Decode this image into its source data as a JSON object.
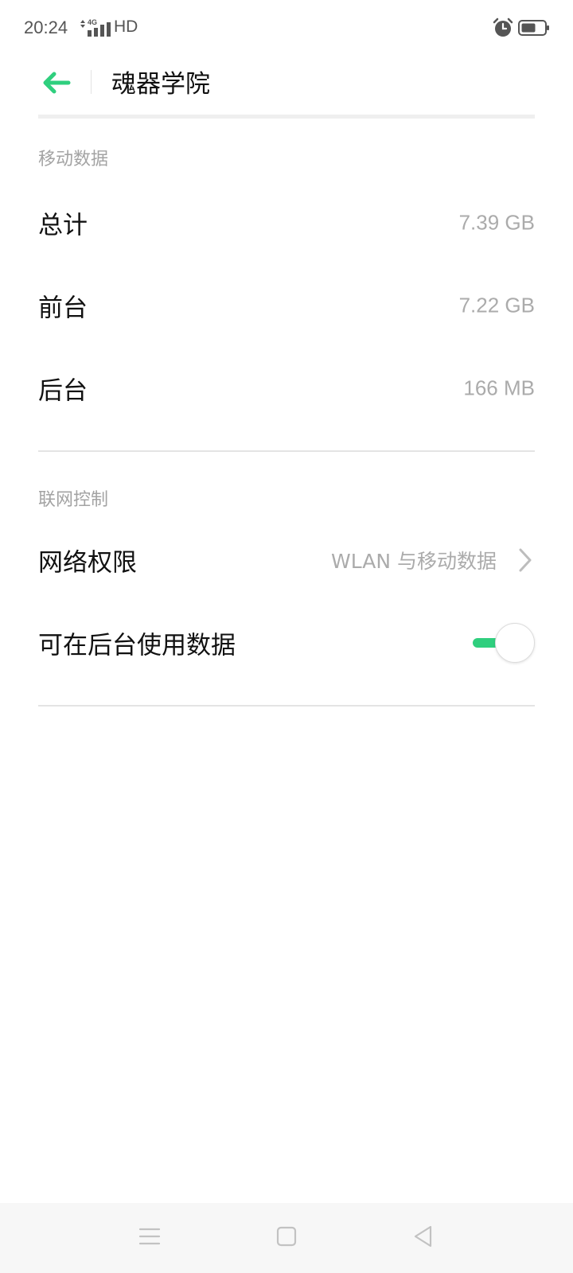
{
  "status_bar": {
    "time": "20:24",
    "network_type": "4G",
    "hd_label": "HD",
    "icons": [
      "alarm-icon",
      "battery-icon"
    ]
  },
  "header": {
    "title": "魂器学院",
    "back_icon": "arrow-left-icon",
    "accent_color": "#2fcf7e"
  },
  "mobile_data": {
    "section_title": "移动数据",
    "rows": [
      {
        "label": "总计",
        "value": "7.39 GB"
      },
      {
        "label": "前台",
        "value": "7.22 GB"
      },
      {
        "label": "后台",
        "value": "166 MB"
      }
    ]
  },
  "network_control": {
    "section_title": "联网控制",
    "permission": {
      "label": "网络权限",
      "value": "WLAN 与移动数据"
    },
    "background_data": {
      "label": "可在后台使用数据",
      "enabled": true
    }
  },
  "nav_bar": {
    "icons": [
      "menu-icon",
      "home-icon",
      "back-triangle-icon"
    ]
  }
}
